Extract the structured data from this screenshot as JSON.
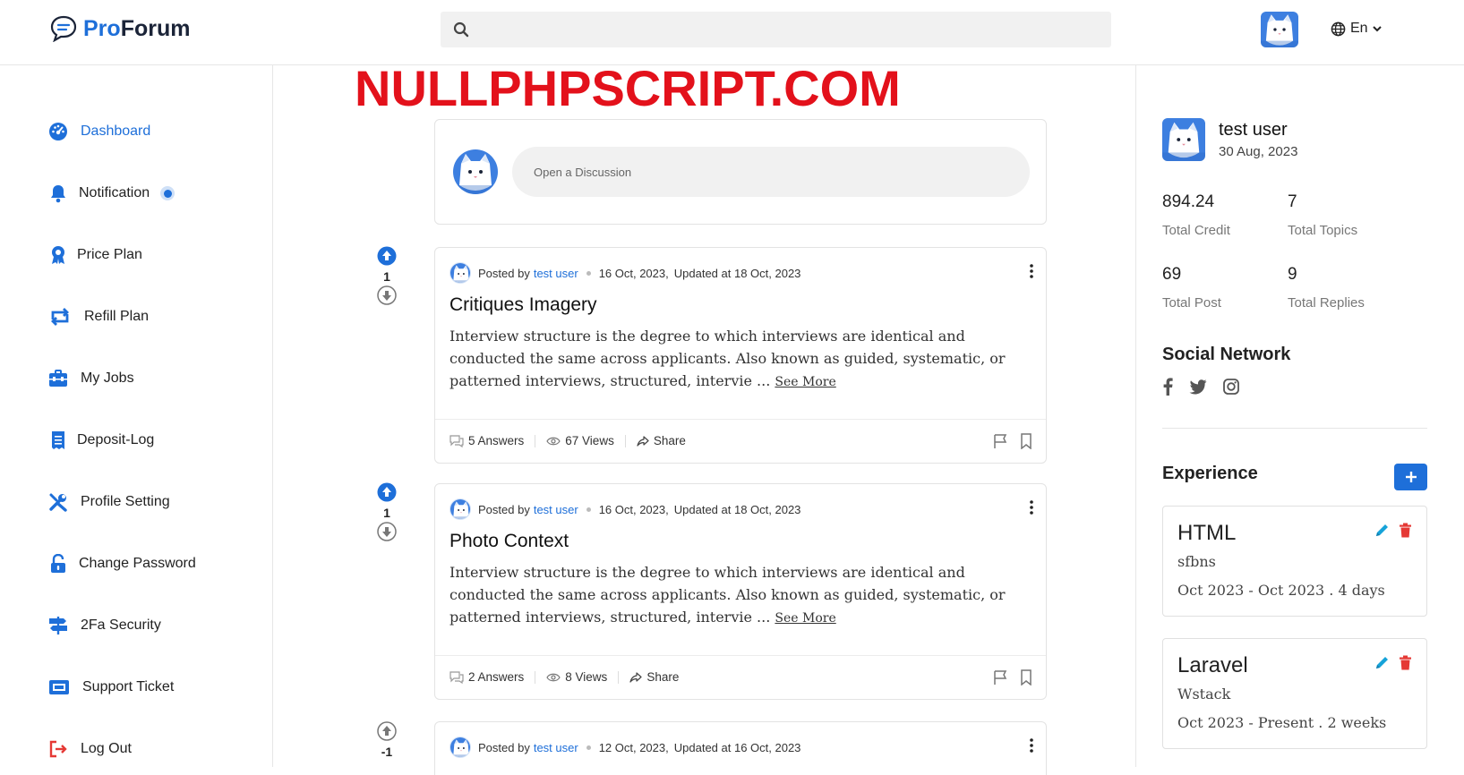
{
  "colors": {
    "accent": "#1e6fd9",
    "danger": "#e53935",
    "edit": "#16a3d9"
  },
  "app": {
    "logo_pro": "Pro",
    "logo_forum": "Forum"
  },
  "header": {
    "search_placeholder": "",
    "language": "En"
  },
  "watermark": "NULLPHPSCRIPT.COM",
  "sidebar": {
    "items": [
      {
        "label": "Dashboard",
        "icon": "dashboard-icon"
      },
      {
        "label": "Notification",
        "icon": "bell-icon"
      },
      {
        "label": "Price Plan",
        "icon": "award-icon"
      },
      {
        "label": "Refill Plan",
        "icon": "refresh-icon"
      },
      {
        "label": "My Jobs",
        "icon": "briefcase-icon"
      },
      {
        "label": "Deposit-Log",
        "icon": "receipt-icon"
      },
      {
        "label": "Profile Setting",
        "icon": "tools-icon"
      },
      {
        "label": "Change Password",
        "icon": "unlock-icon"
      },
      {
        "label": "2Fa Security",
        "icon": "signpost-icon"
      },
      {
        "label": "Support Ticket",
        "icon": "ticket-icon"
      },
      {
        "label": "Log Out",
        "icon": "logout-icon"
      }
    ]
  },
  "composer": {
    "placeholder": "Open a Discussion"
  },
  "posts": [
    {
      "votes": "1",
      "posted_by_prefix": "Posted by",
      "author": "test user",
      "date": "16 Oct, 2023,",
      "updated": "Updated at 18 Oct, 2023",
      "title": "Critiques Imagery",
      "body": "Interview structure is the degree to which interviews are identical and conducted the same across applicants. Also known as guided, systematic, or patterned interviews, structured, intervie ...",
      "see_more": "See More",
      "answers": "5 Answers",
      "views": "67 Views",
      "share": "Share"
    },
    {
      "votes": "1",
      "posted_by_prefix": "Posted by",
      "author": "test user",
      "date": "16 Oct, 2023,",
      "updated": "Updated at 18 Oct, 2023",
      "title": "Photo Context",
      "body": "Interview structure is the degree to which interviews are identical and conducted the same across applicants. Also known as guided, systematic, or patterned interviews, structured, intervie ...",
      "see_more": "See More",
      "answers": "2 Answers",
      "views": "8 Views",
      "share": "Share"
    },
    {
      "votes": "-1",
      "posted_by_prefix": "Posted by",
      "author": "test user",
      "date": "12 Oct, 2023,",
      "updated": "Updated at 16 Oct, 2023"
    }
  ],
  "profile": {
    "name": "test user",
    "date": "30 Aug, 2023",
    "stats": [
      {
        "value": "894.24",
        "label": "Total Credit"
      },
      {
        "value": "7",
        "label": "Total Topics"
      },
      {
        "value": "69",
        "label": "Total Post"
      },
      {
        "value": "9",
        "label": "Total Replies"
      }
    ],
    "social_title": "Social Network",
    "experience_title": "Experience",
    "experiences": [
      {
        "title": "HTML",
        "company": "sfbns",
        "period": "Oct 2023 - Oct 2023 . 4 days"
      },
      {
        "title": "Laravel",
        "company": "Wstack",
        "period": "Oct 2023 - Present . 2 weeks"
      }
    ]
  }
}
